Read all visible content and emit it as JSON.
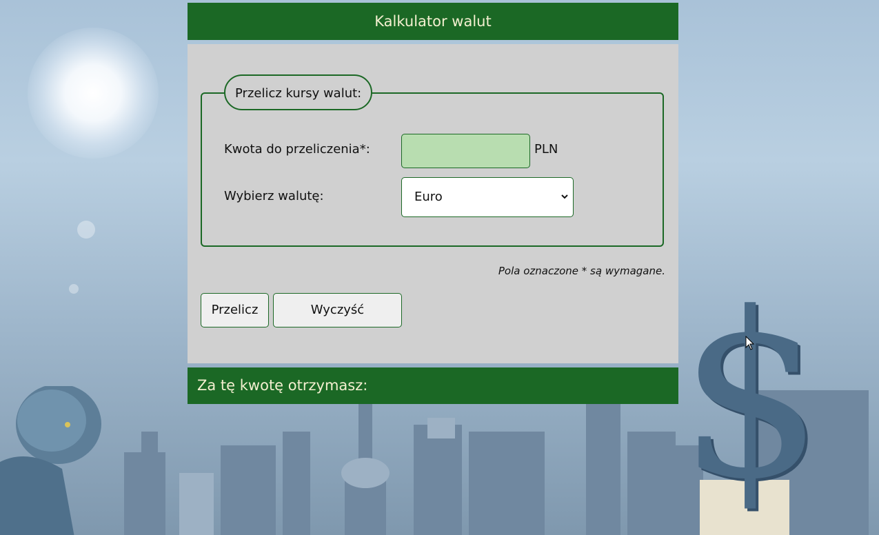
{
  "header": {
    "title": "Kalkulator walut"
  },
  "form": {
    "legend": "Przelicz kursy walut:",
    "amount_label": "Kwota do przeliczenia*:",
    "amount_value": "",
    "amount_unit": "PLN",
    "currency_label": "Wybierz walutę:",
    "currency_selected": "Euro",
    "required_note": "Pola oznaczone * są wymagane.",
    "convert_button": "Przelicz",
    "clear_button": "Wyczyść"
  },
  "result": {
    "label": "Za tę kwotę otrzymasz:"
  },
  "colors": {
    "brand_green": "#1b6825",
    "input_green": "#b8ddb0",
    "panel_gray": "#d0d0d0",
    "header_text": "#f3efd0"
  },
  "icons": [
    "chevron-down-icon",
    "mouse-cursor-icon"
  ]
}
